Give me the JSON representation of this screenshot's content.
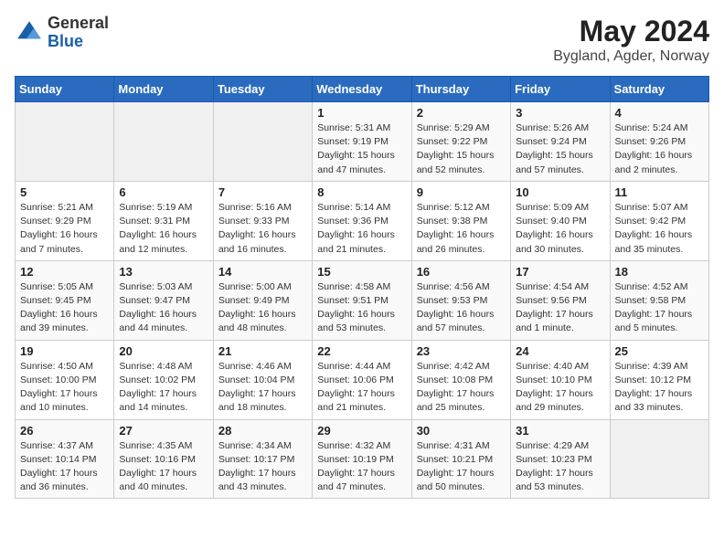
{
  "header": {
    "logo_general": "General",
    "logo_blue": "Blue",
    "title": "May 2024",
    "subtitle": "Bygland, Agder, Norway"
  },
  "weekdays": [
    "Sunday",
    "Monday",
    "Tuesday",
    "Wednesday",
    "Thursday",
    "Friday",
    "Saturday"
  ],
  "weeks": [
    [
      {
        "day": "",
        "info": ""
      },
      {
        "day": "",
        "info": ""
      },
      {
        "day": "",
        "info": ""
      },
      {
        "day": "1",
        "info": "Sunrise: 5:31 AM\nSunset: 9:19 PM\nDaylight: 15 hours and 47 minutes."
      },
      {
        "day": "2",
        "info": "Sunrise: 5:29 AM\nSunset: 9:22 PM\nDaylight: 15 hours and 52 minutes."
      },
      {
        "day": "3",
        "info": "Sunrise: 5:26 AM\nSunset: 9:24 PM\nDaylight: 15 hours and 57 minutes."
      },
      {
        "day": "4",
        "info": "Sunrise: 5:24 AM\nSunset: 9:26 PM\nDaylight: 16 hours and 2 minutes."
      }
    ],
    [
      {
        "day": "5",
        "info": "Sunrise: 5:21 AM\nSunset: 9:29 PM\nDaylight: 16 hours and 7 minutes."
      },
      {
        "day": "6",
        "info": "Sunrise: 5:19 AM\nSunset: 9:31 PM\nDaylight: 16 hours and 12 minutes."
      },
      {
        "day": "7",
        "info": "Sunrise: 5:16 AM\nSunset: 9:33 PM\nDaylight: 16 hours and 16 minutes."
      },
      {
        "day": "8",
        "info": "Sunrise: 5:14 AM\nSunset: 9:36 PM\nDaylight: 16 hours and 21 minutes."
      },
      {
        "day": "9",
        "info": "Sunrise: 5:12 AM\nSunset: 9:38 PM\nDaylight: 16 hours and 26 minutes."
      },
      {
        "day": "10",
        "info": "Sunrise: 5:09 AM\nSunset: 9:40 PM\nDaylight: 16 hours and 30 minutes."
      },
      {
        "day": "11",
        "info": "Sunrise: 5:07 AM\nSunset: 9:42 PM\nDaylight: 16 hours and 35 minutes."
      }
    ],
    [
      {
        "day": "12",
        "info": "Sunrise: 5:05 AM\nSunset: 9:45 PM\nDaylight: 16 hours and 39 minutes."
      },
      {
        "day": "13",
        "info": "Sunrise: 5:03 AM\nSunset: 9:47 PM\nDaylight: 16 hours and 44 minutes."
      },
      {
        "day": "14",
        "info": "Sunrise: 5:00 AM\nSunset: 9:49 PM\nDaylight: 16 hours and 48 minutes."
      },
      {
        "day": "15",
        "info": "Sunrise: 4:58 AM\nSunset: 9:51 PM\nDaylight: 16 hours and 53 minutes."
      },
      {
        "day": "16",
        "info": "Sunrise: 4:56 AM\nSunset: 9:53 PM\nDaylight: 16 hours and 57 minutes."
      },
      {
        "day": "17",
        "info": "Sunrise: 4:54 AM\nSunset: 9:56 PM\nDaylight: 17 hours and 1 minute."
      },
      {
        "day": "18",
        "info": "Sunrise: 4:52 AM\nSunset: 9:58 PM\nDaylight: 17 hours and 5 minutes."
      }
    ],
    [
      {
        "day": "19",
        "info": "Sunrise: 4:50 AM\nSunset: 10:00 PM\nDaylight: 17 hours and 10 minutes."
      },
      {
        "day": "20",
        "info": "Sunrise: 4:48 AM\nSunset: 10:02 PM\nDaylight: 17 hours and 14 minutes."
      },
      {
        "day": "21",
        "info": "Sunrise: 4:46 AM\nSunset: 10:04 PM\nDaylight: 17 hours and 18 minutes."
      },
      {
        "day": "22",
        "info": "Sunrise: 4:44 AM\nSunset: 10:06 PM\nDaylight: 17 hours and 21 minutes."
      },
      {
        "day": "23",
        "info": "Sunrise: 4:42 AM\nSunset: 10:08 PM\nDaylight: 17 hours and 25 minutes."
      },
      {
        "day": "24",
        "info": "Sunrise: 4:40 AM\nSunset: 10:10 PM\nDaylight: 17 hours and 29 minutes."
      },
      {
        "day": "25",
        "info": "Sunrise: 4:39 AM\nSunset: 10:12 PM\nDaylight: 17 hours and 33 minutes."
      }
    ],
    [
      {
        "day": "26",
        "info": "Sunrise: 4:37 AM\nSunset: 10:14 PM\nDaylight: 17 hours and 36 minutes."
      },
      {
        "day": "27",
        "info": "Sunrise: 4:35 AM\nSunset: 10:16 PM\nDaylight: 17 hours and 40 minutes."
      },
      {
        "day": "28",
        "info": "Sunrise: 4:34 AM\nSunset: 10:17 PM\nDaylight: 17 hours and 43 minutes."
      },
      {
        "day": "29",
        "info": "Sunrise: 4:32 AM\nSunset: 10:19 PM\nDaylight: 17 hours and 47 minutes."
      },
      {
        "day": "30",
        "info": "Sunrise: 4:31 AM\nSunset: 10:21 PM\nDaylight: 17 hours and 50 minutes."
      },
      {
        "day": "31",
        "info": "Sunrise: 4:29 AM\nSunset: 10:23 PM\nDaylight: 17 hours and 53 minutes."
      },
      {
        "day": "",
        "info": ""
      }
    ]
  ]
}
